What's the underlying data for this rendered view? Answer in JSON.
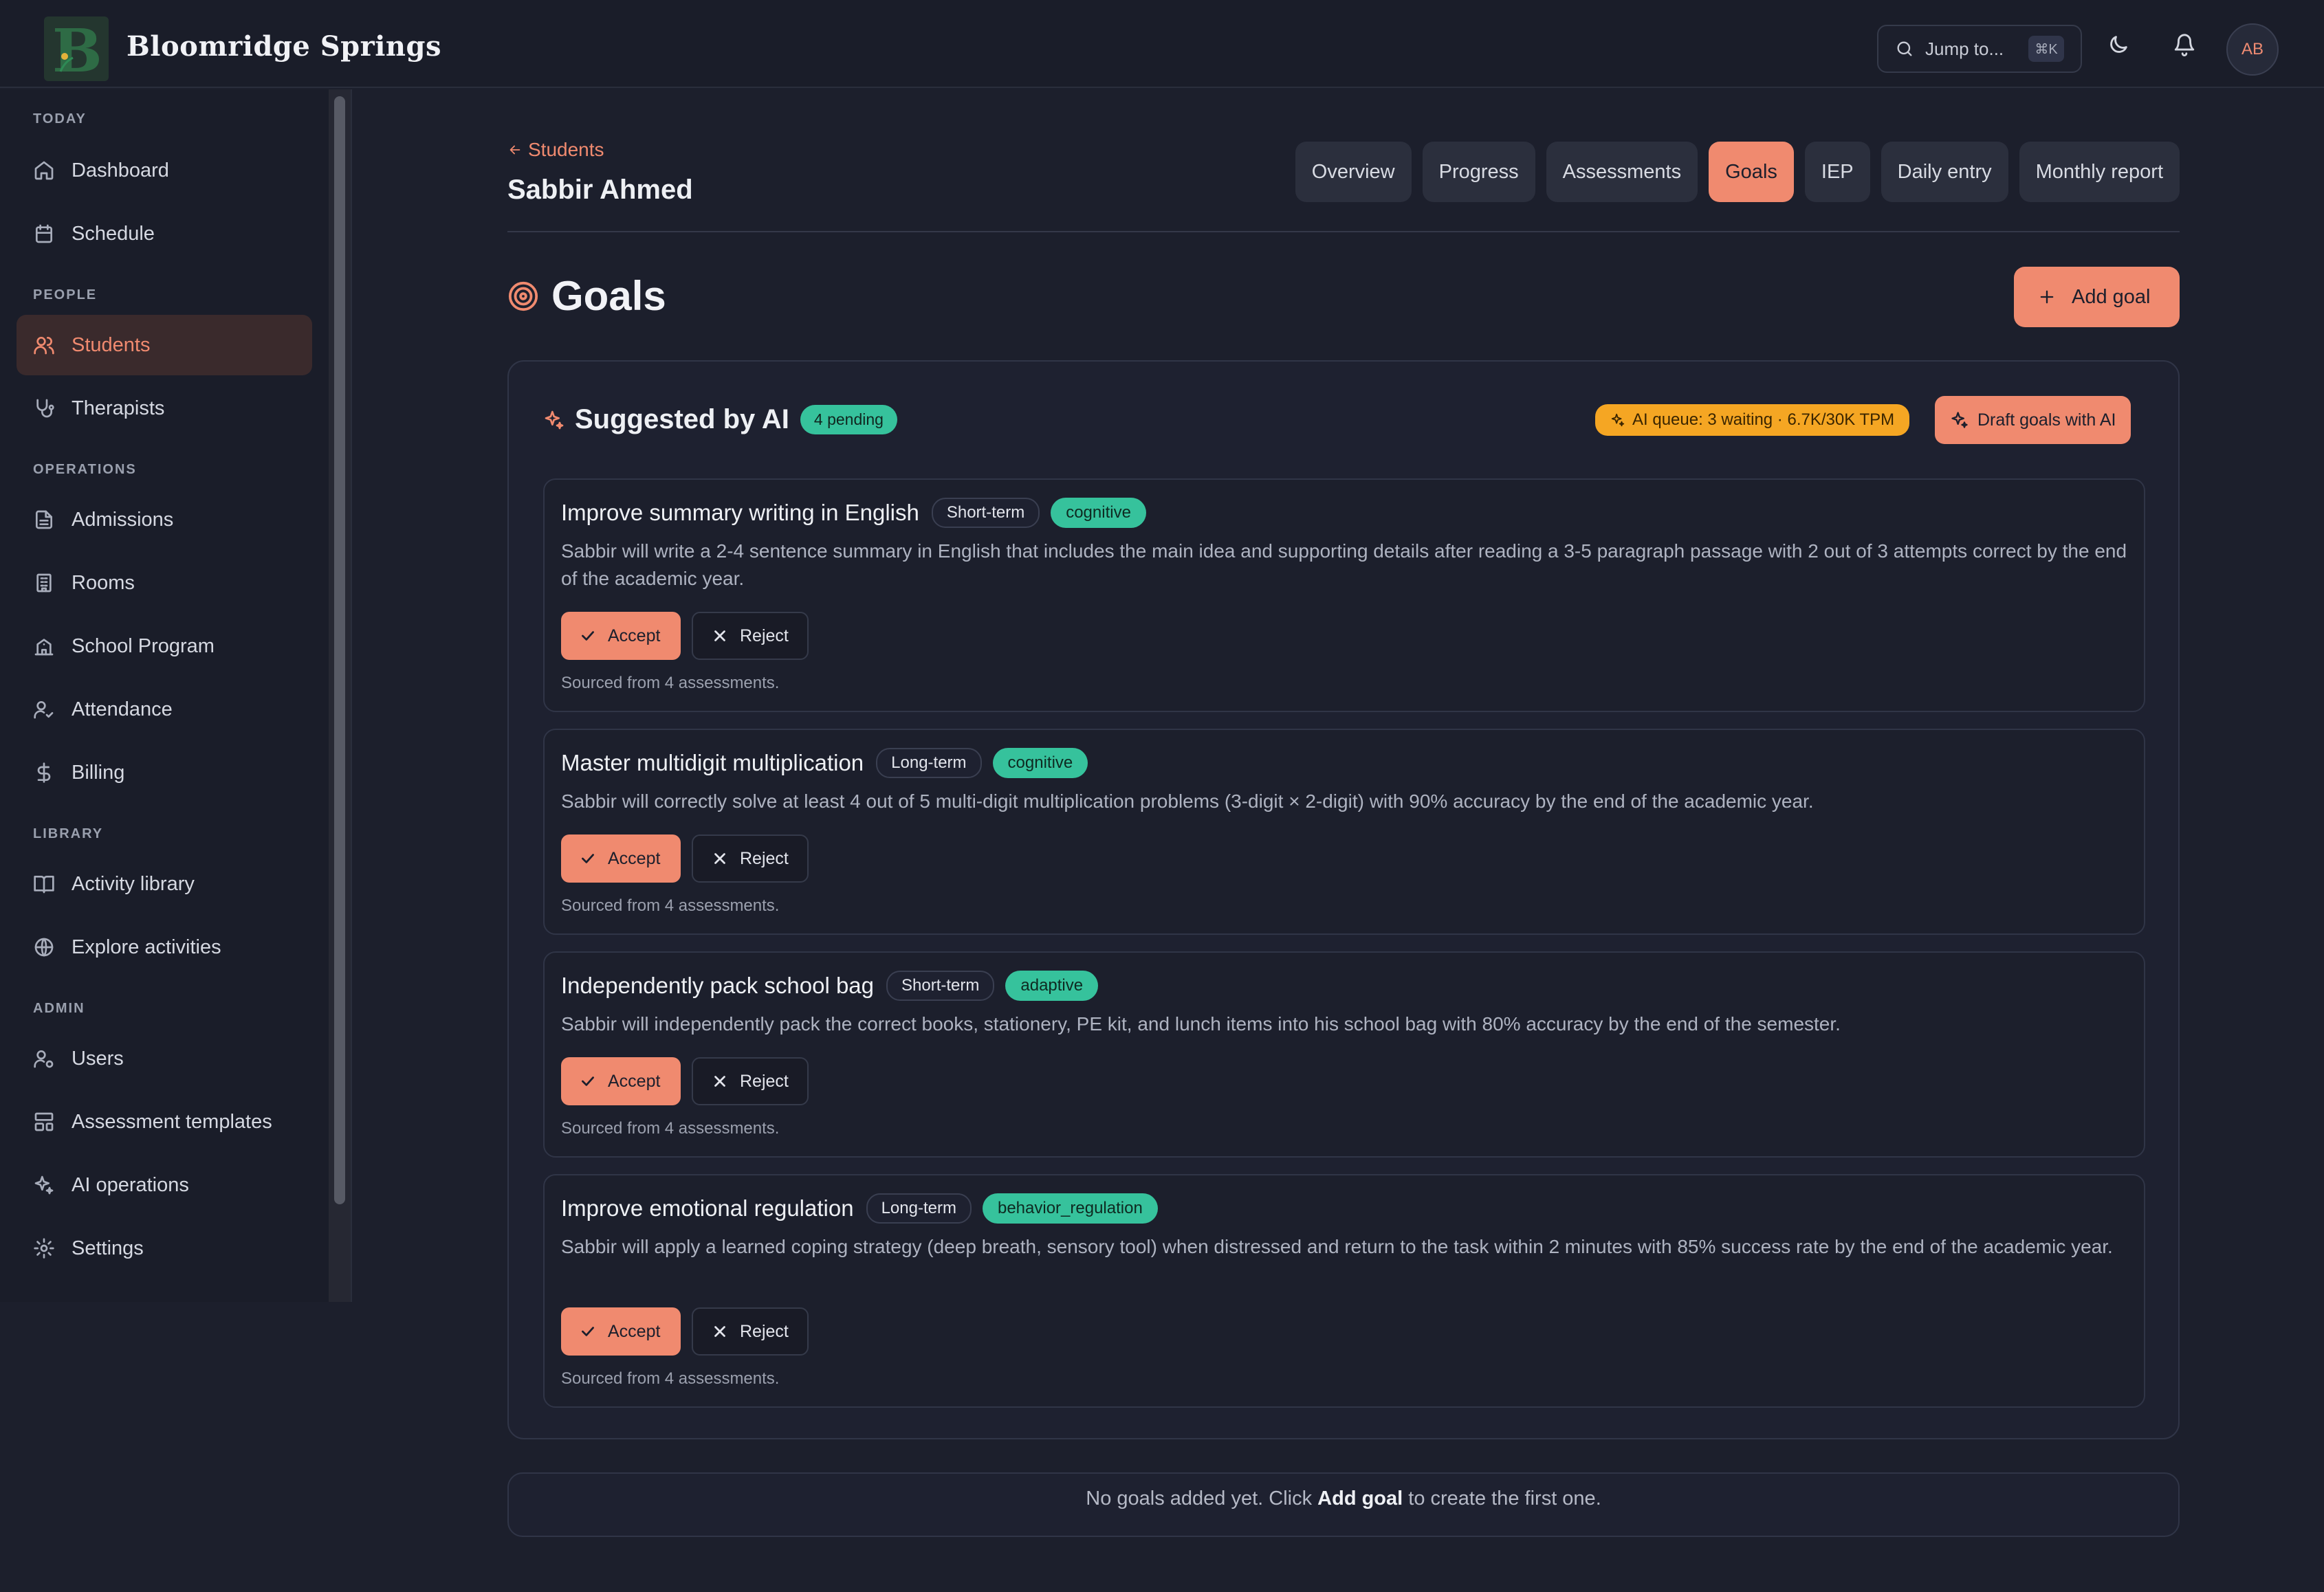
{
  "app": {
    "brand": "Bloomridge Springs",
    "search_label": "Jump to...",
    "search_shortcut": "⌘K",
    "avatar_initials": "AB",
    "accent_color": "#f08a6f"
  },
  "sidebar": {
    "sections": [
      {
        "title": "TODAY",
        "items": [
          {
            "label": "Dashboard",
            "icon": "home-icon"
          },
          {
            "label": "Schedule",
            "icon": "calendar-icon"
          }
        ]
      },
      {
        "title": "PEOPLE",
        "items": [
          {
            "label": "Students",
            "icon": "users-icon",
            "active": true
          },
          {
            "label": "Therapists",
            "icon": "stethoscope-icon"
          }
        ]
      },
      {
        "title": "OPERATIONS",
        "items": [
          {
            "label": "Admissions",
            "icon": "file-icon"
          },
          {
            "label": "Rooms",
            "icon": "building-icon"
          },
          {
            "label": "School Program",
            "icon": "school-icon"
          },
          {
            "label": "Attendance",
            "icon": "user-check-icon"
          },
          {
            "label": "Billing",
            "icon": "dollar-icon"
          }
        ]
      },
      {
        "title": "LIBRARY",
        "items": [
          {
            "label": "Activity library",
            "icon": "book-icon"
          },
          {
            "label": "Explore activities",
            "icon": "globe-icon"
          }
        ]
      },
      {
        "title": "ADMIN",
        "items": [
          {
            "label": "Users",
            "icon": "user-cog-icon"
          },
          {
            "label": "Assessment templates",
            "icon": "layout-icon"
          },
          {
            "label": "AI operations",
            "icon": "sparkles-icon"
          },
          {
            "label": "Settings",
            "icon": "gear-icon"
          }
        ]
      }
    ]
  },
  "header": {
    "back_label": "Students",
    "student_name": "Sabbir Ahmed",
    "tabs": [
      {
        "label": "Overview"
      },
      {
        "label": "Progress"
      },
      {
        "label": "Assessments"
      },
      {
        "label": "Goals",
        "active": true
      },
      {
        "label": "IEP"
      },
      {
        "label": "Daily entry"
      },
      {
        "label": "Monthly report"
      }
    ]
  },
  "goals": {
    "title": "Goals",
    "add_label": "Add goal",
    "ai": {
      "title": "Suggested by AI",
      "pending": "4 pending",
      "queue": "AI queue: 3 waiting · 6.7K/30K TPM",
      "draft_label": "Draft goals with AI",
      "accept_label": "Accept",
      "reject_label": "Reject",
      "suggestions": [
        {
          "title": "Improve summary writing in English",
          "term": "Short-term",
          "domain": "cognitive",
          "description": "Sabbir will write a 2-4 sentence summary in English that includes the main idea and supporting details after reading a 3-5 paragraph passage with 2 out of 3 attempts correct by the end of the academic year.",
          "source": "Sourced from 4 assessments."
        },
        {
          "title": "Master multidigit multiplication",
          "term": "Long-term",
          "domain": "cognitive",
          "description": "Sabbir will correctly solve at least 4 out of 5 multi-digit multiplication problems (3-digit × 2-digit) with 90% accuracy by the end of the academic year.",
          "source": "Sourced from 4 assessments."
        },
        {
          "title": "Independently pack school bag",
          "term": "Short-term",
          "domain": "adaptive",
          "description": "Sabbir will independently pack the correct books, stationery, PE kit, and lunch items into his school bag with 80% accuracy by the end of the semester.",
          "source": "Sourced from 4 assessments."
        },
        {
          "title": "Improve emotional regulation",
          "term": "Long-term",
          "domain": "behavior_regulation",
          "description": "Sabbir will apply a learned coping strategy (deep breath, sensory tool) when distressed and return to the task within 2 minutes with 85% success rate by the end of the academic year.",
          "source": "Sourced from 4 assessments."
        }
      ]
    },
    "empty": {
      "prefix": "No goals added yet. Click ",
      "strong": "Add goal",
      "suffix": " to create the first one."
    }
  }
}
